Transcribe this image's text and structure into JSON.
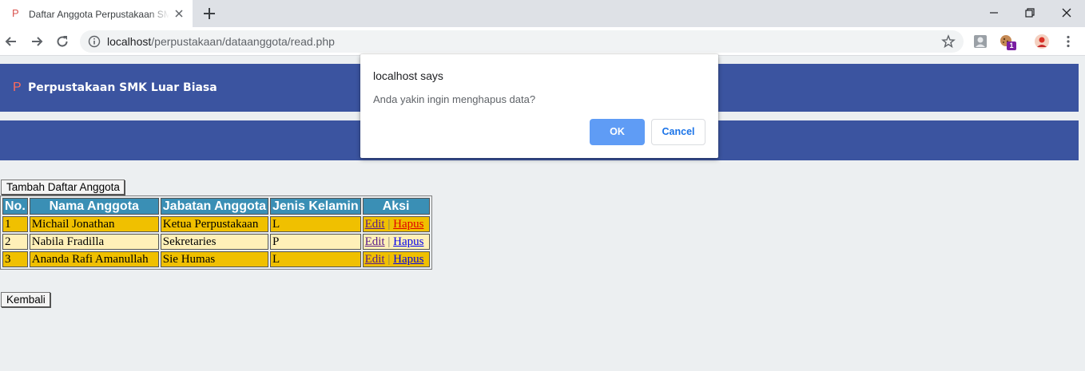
{
  "browser": {
    "tab_favicon": "P",
    "tab_title": "Daftar Anggota Perpustakaan SMK Luar Biasa",
    "url_host": "localhost",
    "url_path": "/perpustakaan/dataanggota/read.php",
    "extension_badge": "1"
  },
  "page": {
    "banner_logo": "P",
    "banner_title": "Perpustakaan SMK Luar Biasa",
    "add_button": "Tambah Daftar Anggota",
    "back_button": "Kembali",
    "table": {
      "headers": [
        "No.",
        "Nama Anggota",
        "Jabatan Anggota",
        "Jenis Kelamin",
        "Aksi"
      ],
      "rows": [
        {
          "no": "1",
          "nama": "Michail Jonathan",
          "jabatan": "Ketua Perpustakaan",
          "jk": "L",
          "edit": "Edit",
          "sep": "|",
          "hapus": "Hapus"
        },
        {
          "no": "2",
          "nama": "Nabila Fradilla",
          "jabatan": "Sekretaries",
          "jk": "P",
          "edit": "Edit",
          "sep": "|",
          "hapus": "Hapus"
        },
        {
          "no": "3",
          "nama": "Ananda Rafi Amanullah",
          "jabatan": "Sie Humas",
          "jk": "L",
          "edit": "Edit",
          "sep": "|",
          "hapus": "Hapus"
        }
      ]
    }
  },
  "dialog": {
    "title": "localhost says",
    "message": "Anda yakin ingin menghapus data?",
    "ok": "OK",
    "cancel": "Cancel"
  },
  "colors": {
    "banner": "#3b54a0",
    "header_cell": "#3a8fb5",
    "row_odd": "#f0c000",
    "row_even": "#fff0b8",
    "dialog_ok": "#5f9cf5"
  }
}
